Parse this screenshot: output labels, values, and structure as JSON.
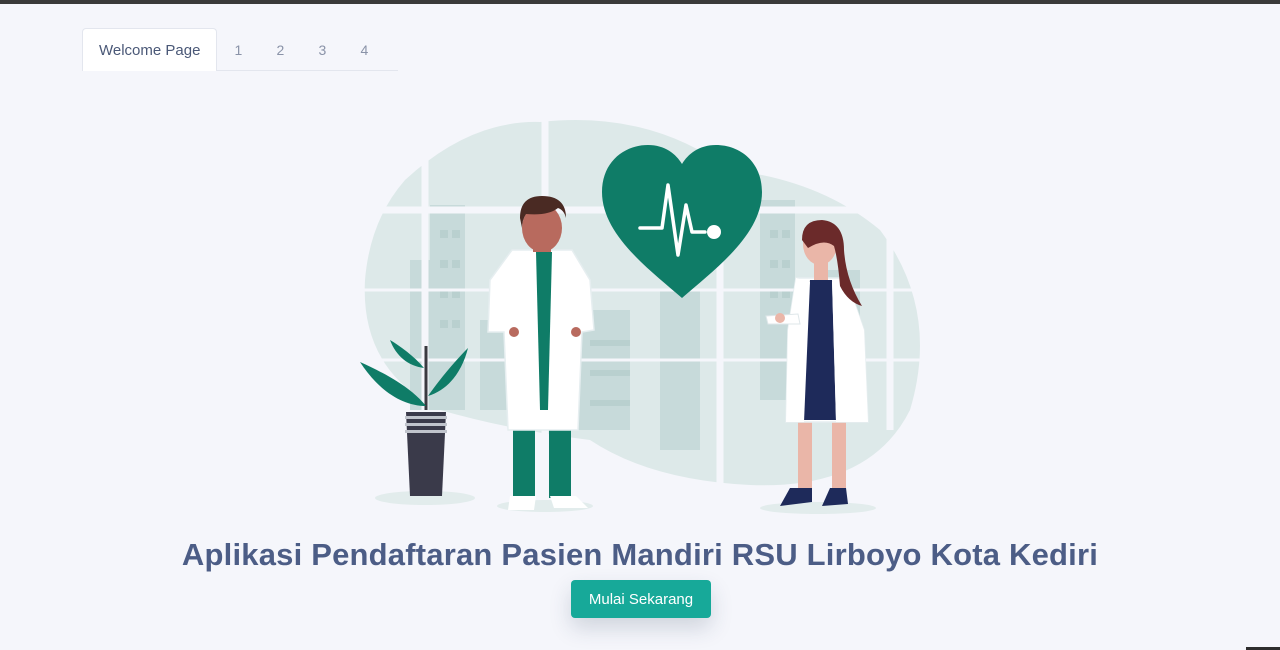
{
  "tabs": [
    {
      "label": "Welcome Page",
      "active": true
    },
    {
      "label": "1",
      "active": false
    },
    {
      "label": "2",
      "active": false
    },
    {
      "label": "3",
      "active": false
    },
    {
      "label": "4",
      "active": false
    }
  ],
  "illustration": {
    "icons": [
      "heart-pulse-icon",
      "doctor-male",
      "doctor-female",
      "potted-plant",
      "city-window-background"
    ],
    "colors": {
      "primary": "#0f7c67",
      "background_shape": "#dde9e9",
      "coat": "#ffffff",
      "skin": "#b86a5e",
      "hair": "#4a2a23",
      "dress": "#1e2a5a"
    }
  },
  "main": {
    "headline": "Aplikasi Pendaftaran Pasien Mandiri RSU Lirboyo Kota Kediri",
    "cta_label": "Mulai Sekarang"
  },
  "theme": {
    "accent": "#17a999",
    "headline_color": "#4c5d86",
    "background": "#f5f6fb"
  }
}
